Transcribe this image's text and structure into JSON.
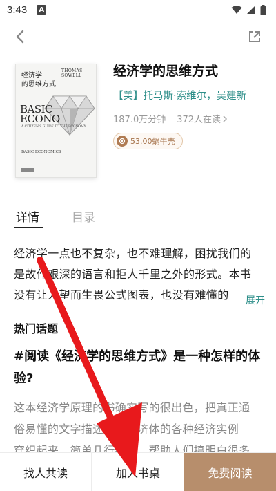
{
  "status_bar": {
    "time": "3:43",
    "notification_letter": "A"
  },
  "book": {
    "title": "经济学的思维方式",
    "authors": "【美】托马斯·索维尔，吴建新",
    "duration": "187.0万分钟",
    "readers": "372人在读",
    "price": "53.00蜗牛壳",
    "cover": {
      "cn_title": "经济学\n的思维方式",
      "author": "THOMAS SOWELL",
      "big_title": "BASIC\nECONO",
      "subtitle": "A CITIZEN'S GUIDE TO THE ECONOMY",
      "bottom": "BASIC ECONOMICS"
    }
  },
  "tabs": [
    {
      "label": "详情"
    },
    {
      "label": "目录"
    }
  ],
  "description": {
    "lines": [
      "经济学一点也不复杂，也不难理解，困扰我们的",
      "是故作艰深的语言和拒人千里之外的形式。本书",
      "没有让人望而生畏公式图表，也没有难懂的"
    ],
    "expand_label": "展开"
  },
  "hot_topics": {
    "heading": "热门话题",
    "topic_title": "#阅读《经济学的思维方式》是一种怎样的体验?",
    "body_lines": [
      "这本经济学原理的书确实写的很出色，把真正通",
      "俗易懂的文字描述世界经济体的各种经济实例",
      "穿织起来，简单几行推理，帮助人们搞明白很多"
    ]
  },
  "bottom_bar": {
    "share_label": "找人共读",
    "shelf_label": "加入书桌",
    "read_label": "免费阅读"
  },
  "colors": {
    "accent_teal": "#2e8f8a",
    "read_button": "#b78e6c",
    "arrow_red": "#e8191c"
  }
}
